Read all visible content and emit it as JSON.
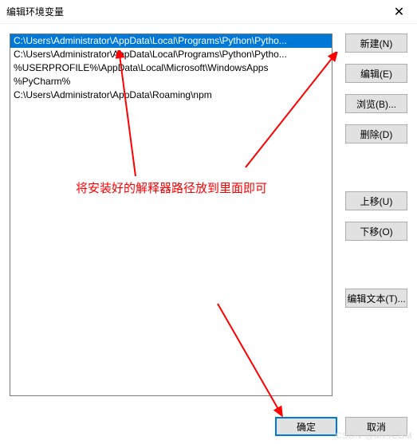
{
  "titlebar": {
    "title": "编辑环境变量"
  },
  "list": {
    "items": [
      "C:\\Users\\Administrator\\AppData\\Local\\Programs\\Python\\Pytho...",
      "C:\\Users\\Administrator\\AppData\\Local\\Programs\\Python\\Pytho...",
      "%USERPROFILE%\\AppData\\Local\\Microsoft\\WindowsApps",
      "%PyCharm%",
      "C:\\Users\\Administrator\\AppData\\Roaming\\npm"
    ],
    "selected_index": 0
  },
  "buttons": {
    "new": "新建(N)",
    "edit": "编辑(E)",
    "browse": "浏览(B)...",
    "delete": "删除(D)",
    "moveup": "上移(U)",
    "movedown": "下移(O)",
    "edittext": "编辑文本(T)...",
    "ok": "确定",
    "cancel": "取消"
  },
  "annotation": {
    "text": "将安装好的解释器路径放到里面即可"
  },
  "watermark": "CSDN @Mv.ICBM"
}
